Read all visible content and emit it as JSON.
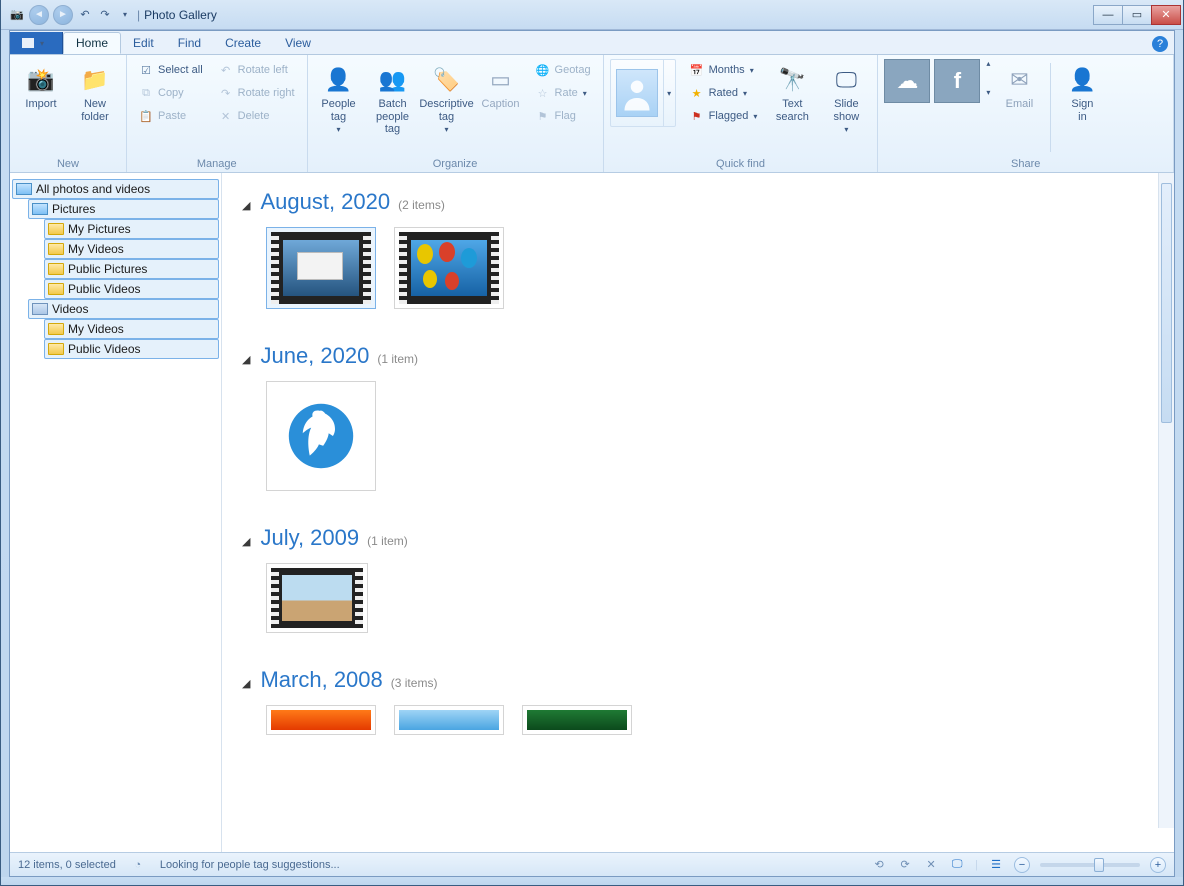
{
  "window": {
    "title": "Photo Gallery"
  },
  "tabs": {
    "file": "",
    "home": "Home",
    "edit": "Edit",
    "find": "Find",
    "create": "Create",
    "view": "View"
  },
  "ribbon": {
    "new": {
      "label": "New",
      "import": "Import",
      "newfolder": "New\nfolder"
    },
    "manage": {
      "label": "Manage",
      "select_all": "Select all",
      "copy": "Copy",
      "paste": "Paste",
      "rotate_left": "Rotate left",
      "rotate_right": "Rotate right",
      "delete": "Delete"
    },
    "organize": {
      "label": "Organize",
      "people_tag": "People\ntag",
      "batch": "Batch\npeople tag",
      "desc_tag": "Descriptive\ntag",
      "caption": "Caption",
      "geotag": "Geotag",
      "rate": "Rate",
      "flag": "Flag"
    },
    "quick": {
      "label": "Quick find",
      "months": "Months",
      "rated": "Rated",
      "flagged": "Flagged",
      "text_search": "Text\nsearch",
      "slide_show": "Slide\nshow"
    },
    "share": {
      "label": "Share",
      "email": "Email",
      "signin": "Sign\nin"
    }
  },
  "tree": {
    "root": "All photos and videos",
    "pictures": "Pictures",
    "my_pictures": "My Pictures",
    "my_videos": "My Videos",
    "public_pictures": "Public Pictures",
    "public_videos": "Public Videos",
    "videos": "Videos",
    "my_videos2": "My Videos",
    "public_videos2": "Public Videos"
  },
  "groups": [
    {
      "title": "August, 2020",
      "count": "(2 items)"
    },
    {
      "title": "June, 2020",
      "count": "(1 item)"
    },
    {
      "title": "July, 2009",
      "count": "(1 item)"
    },
    {
      "title": "March, 2008",
      "count": "(3 items)"
    }
  ],
  "status": {
    "items": "12 items, 0 selected",
    "people": "Looking for people tag suggestions..."
  }
}
